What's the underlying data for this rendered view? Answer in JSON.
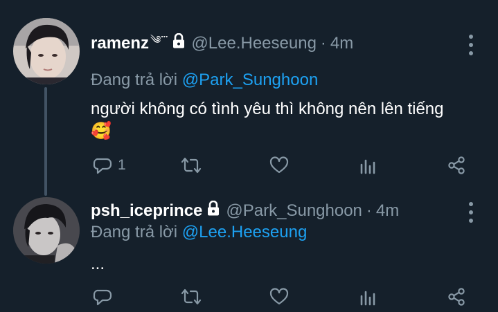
{
  "tweets": [
    {
      "display_name": "ramenz",
      "name_decoration": "༄་་་",
      "handle": "@Lee.Heeseung",
      "sep": "·",
      "time": "4m",
      "reply_prefix": "Đang trả lời",
      "reply_to": "@Park_Sunghoon",
      "text": "người không có tình yêu thì không nên lên tiếng",
      "emoji": "🥰",
      "reply_count": "1"
    },
    {
      "display_name": "psh_iceprince",
      "handle": "@Park_Sunghoon",
      "sep": "·",
      "time": "4m",
      "reply_prefix": "Đang trả lời",
      "reply_to": "@Lee.Heeseung",
      "text": "..."
    }
  ],
  "icons": {
    "lock": "lock-icon",
    "more": "more-vertical-icon",
    "reply": "reply-icon",
    "retweet": "retweet-icon",
    "like": "heart-icon",
    "stats": "analytics-icon",
    "share": "share-icon"
  },
  "colors": {
    "background": "#15202b",
    "text_primary": "#ffffff",
    "text_secondary": "#8899a6",
    "accent": "#1da1f2"
  }
}
